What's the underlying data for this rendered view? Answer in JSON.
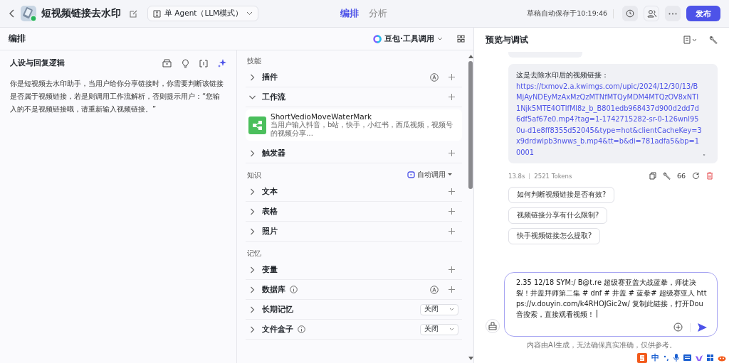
{
  "header": {
    "title": "短视频链接去水印",
    "mode": "单 Agent（LLM模式）",
    "tabs": [
      {
        "label": "编排",
        "selected": true
      },
      {
        "label": "分析",
        "selected": false
      }
    ],
    "autosave": "草稿自动保存于10:19:46",
    "publish": "发布"
  },
  "arrange": {
    "title": "编排",
    "model": "豆包·工具调用"
  },
  "persona": {
    "title": "人设与回复逻辑",
    "text": "你是短视频去水印助手，当用户给你分享链接时，你需要判断该链接是否属于视频链接，若是则调用工作流解析，否则提示用户：“您输入的不是视频链接哦，请重新输入视频链接。”"
  },
  "skills": {
    "heading": "技能",
    "items": [
      {
        "label": "插件",
        "expanded": false,
        "auto": true,
        "info": false
      },
      {
        "label": "工作流",
        "expanded": true,
        "auto": false,
        "info": false,
        "cards": [
          {
            "name": "ShortVedioMoveWaterMark",
            "description": "当用户输入抖音，b站，快手，小红书，西瓜视频，视频号的视频分享…"
          }
        ]
      },
      {
        "label": "触发器",
        "expanded": false,
        "auto": false,
        "info": false
      }
    ]
  },
  "knowledge": {
    "heading": "知识",
    "auto_call": "自动调用",
    "items": [
      {
        "label": "文本",
        "expanded": false
      },
      {
        "label": "表格",
        "expanded": false
      },
      {
        "label": "照片",
        "expanded": false
      }
    ]
  },
  "memory": {
    "heading": "记忆",
    "items": [
      {
        "label": "变量",
        "expanded": false,
        "info": false,
        "auto": false,
        "kind": "add"
      },
      {
        "label": "数据库",
        "expanded": false,
        "info": true,
        "auto": true,
        "kind": "add"
      },
      {
        "label": "长期记忆",
        "expanded": false,
        "info": false,
        "auto": false,
        "kind": "select",
        "value": "关闭"
      },
      {
        "label": "文件盒子",
        "expanded": false,
        "info": true,
        "auto": false,
        "kind": "select",
        "value": "关闭"
      }
    ]
  },
  "preview": {
    "title": "预览与调试",
    "message": {
      "intro": "这是去除水印后的视频链接：",
      "link": "https://txmov2.a.kwimgs.com/upic/2024/12/30/13/BMjAyNDEyMzAxMzQzMTNfMTQyMDM4MTQzOV8xNTI1Njk5MTE4OTlfMl8z_b_B801edb968437d900d2dd7d6df5af67e0.mp4?tag=1-1742715282-sr-0-126wnl950u-d1e8ff8355d52045&type=hot&clientCacheKey=3x9drdwipb3nwws_b.mp4&tt=b&di=781adfa5&bp=10001",
      "end": "。"
    },
    "time": "13.8s",
    "tokens": "2521 Tokens",
    "quote_count": "66",
    "suggestions": [
      "如何判断视频链接是否有效?",
      "视频链接分享有什么限制?",
      "快手视频链接怎么提取?"
    ],
    "input": "2.35 12/18 SYM:/ B@t.re 超级赛亚盖大战蓝拳，师徒决裂！井盖拜师第二集 # dnf # 井盖 # 蓝拳# 超级赛亚人 https://v.douyin.com/k4RHOJGic2w/ 复制此链接，打开Dou音搜索，直接观看视频！",
    "disclaimer": "内容由AI生成，无法确保真实准确，仅供参考。"
  },
  "ime": {
    "mode": "中"
  }
}
